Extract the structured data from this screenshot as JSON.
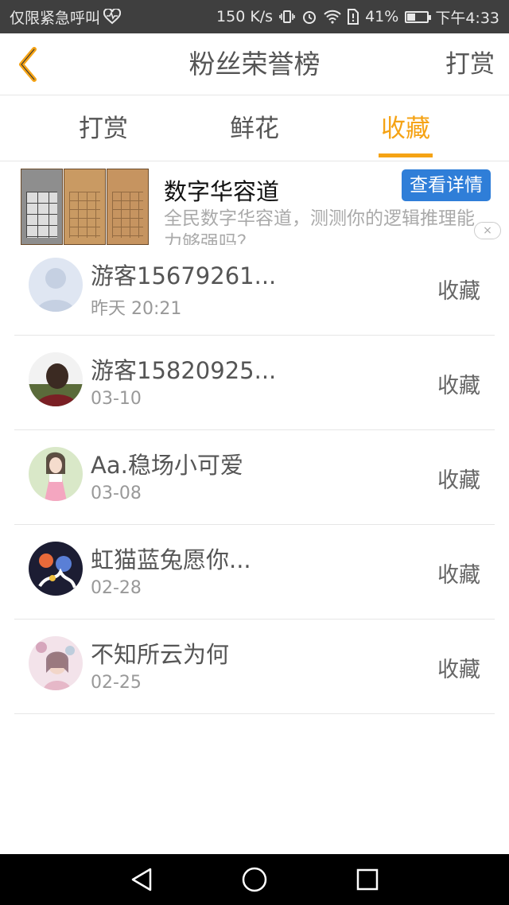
{
  "status_bar": {
    "carrier_text": "仅限紧急呼叫",
    "speed": "150 K/s",
    "battery": "41%",
    "battery_level": 0.41,
    "time": "下午4:33"
  },
  "header": {
    "title": "粉丝荣誉榜",
    "action_label": "打赏"
  },
  "tabs": [
    {
      "label": "打赏",
      "active": false
    },
    {
      "label": "鲜花",
      "active": false
    },
    {
      "label": "收藏",
      "active": true
    }
  ],
  "ad": {
    "title": "数字华容道",
    "description": "全民数字华容道，测测你的逻辑推理能力够强吗？",
    "button_label": "查看详情",
    "close_label": "×"
  },
  "list": [
    {
      "name": "游客15679261...",
      "date": "昨天 20:21",
      "action": "收藏",
      "avatar": "default-avatar"
    },
    {
      "name": "游客15820925...",
      "date": "03-10",
      "action": "收藏",
      "avatar": "person-photo"
    },
    {
      "name": "Aa.稳场小可爱",
      "date": "03-08",
      "action": "收藏",
      "avatar": "girl-photo"
    },
    {
      "name": "虹猫蓝兔愿你...",
      "date": "02-28",
      "action": "收藏",
      "avatar": "anime-photo"
    },
    {
      "name": "不知所云为何",
      "date": "02-25",
      "action": "收藏",
      "avatar": "illustration-photo"
    }
  ],
  "colors": {
    "accent": "#f5a315",
    "ad_button": "#2f7ed8",
    "status_bar": "#3f3f3f"
  }
}
